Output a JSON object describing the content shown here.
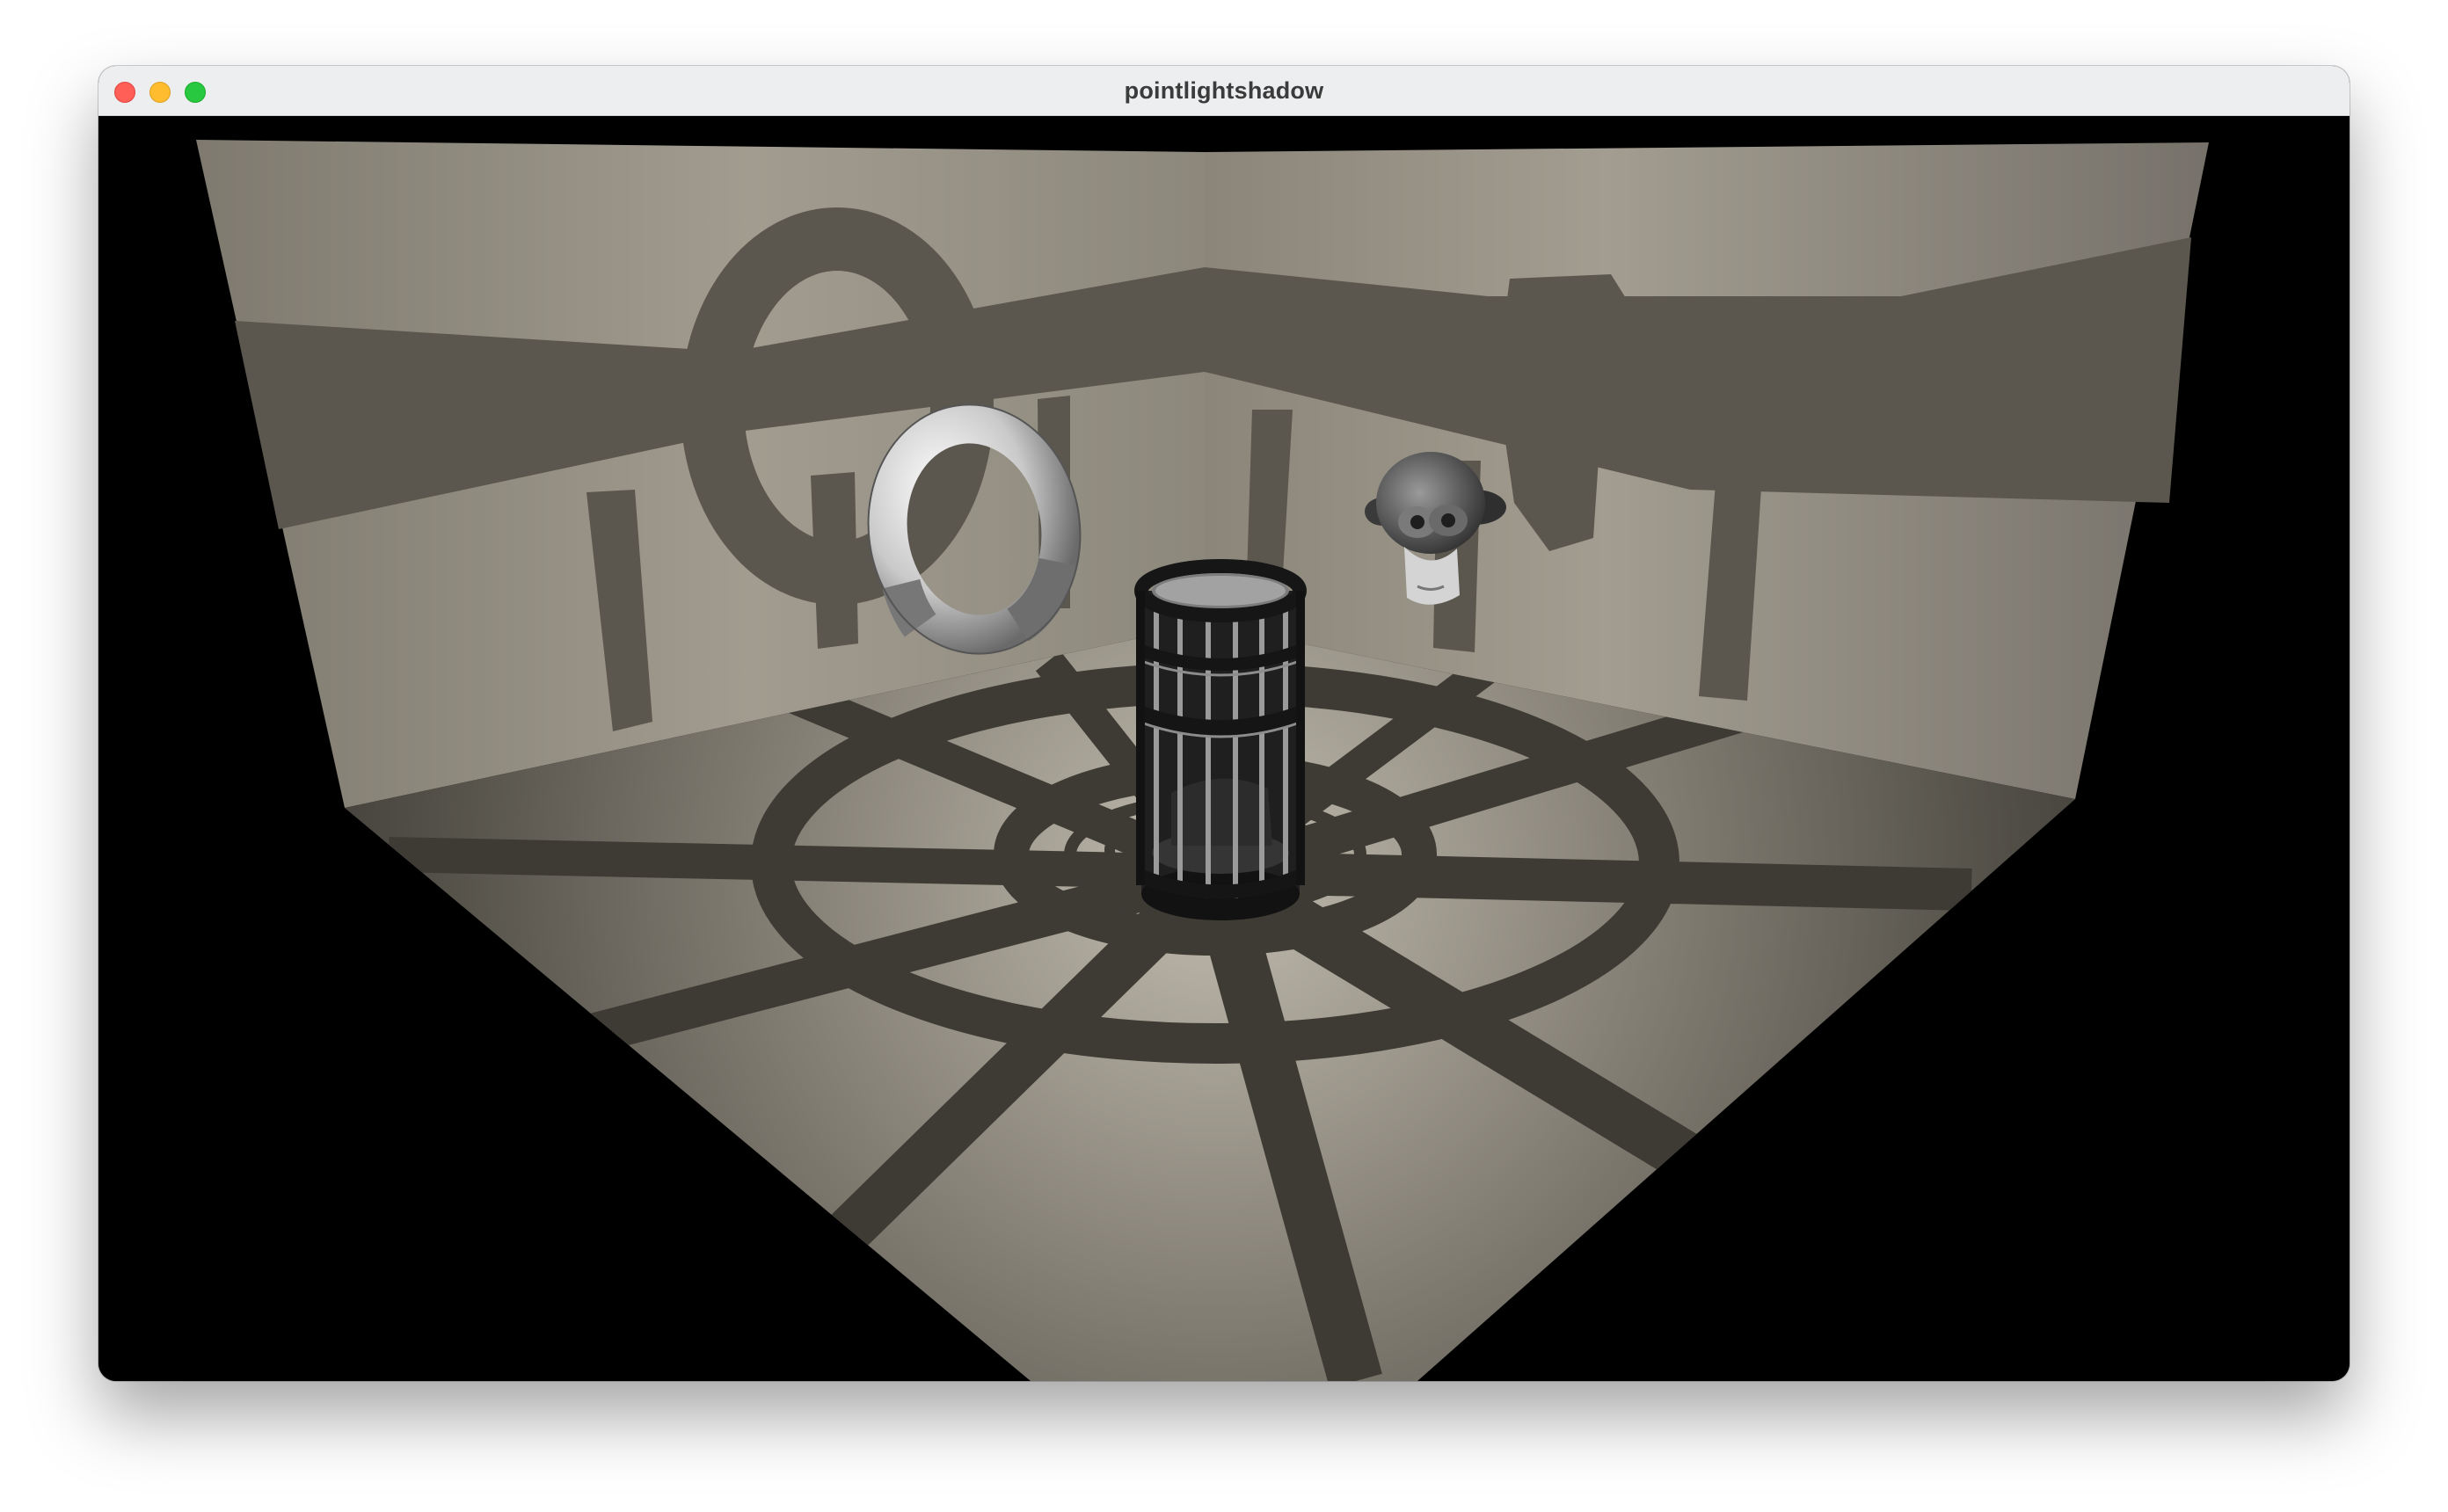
{
  "window": {
    "title": "pointlightshadow"
  },
  "scene": {
    "objects": [
      "room",
      "torus",
      "cylinder-cage",
      "monkey-head",
      "point-light"
    ],
    "colors": {
      "background": "#000000",
      "wall_light": "#a39e91",
      "wall_dark": "#7d786d",
      "shadow": "#4a4740",
      "floor_center": "#bab5a8",
      "floor_edge": "#3f3c36"
    }
  }
}
